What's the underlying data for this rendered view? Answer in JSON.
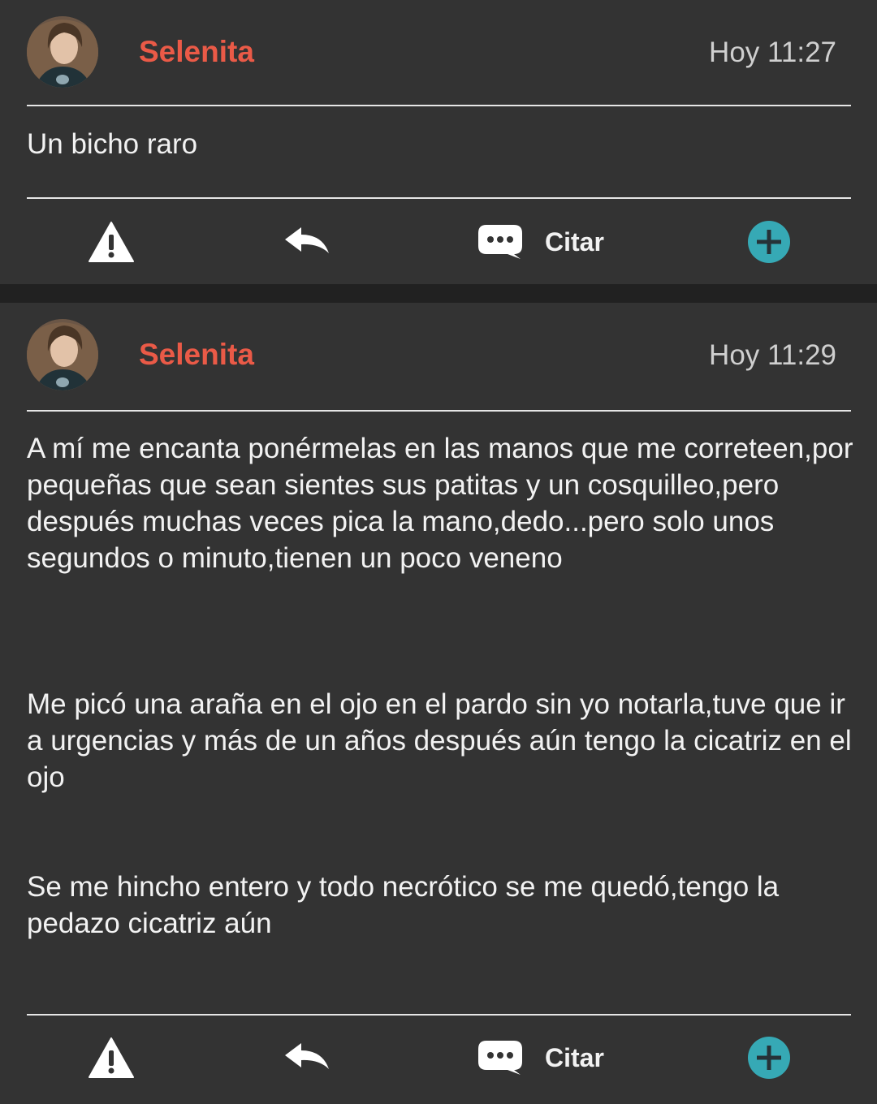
{
  "posts": [
    {
      "author": "Selenita",
      "time": "Hoy 11:27",
      "paragraphs": [
        "Un bicho raro"
      ],
      "actions": {
        "quote_label": "Citar"
      }
    },
    {
      "author": "Selenita",
      "time": "Hoy 11:29",
      "paragraphs": [
        "A mí me encanta ponérmelas en las manos que me correteen,por pequeñas que sean sientes sus patitas y un cosquilleo,pero después muchas veces pica la mano,dedo...pero solo unos segundos o minuto,tienen un poco veneno",
        "Me picó una araña en el ojo en el pardo sin yo notarla,tuve que ir a urgencias y más de un años después aún tengo la cicatriz en el ojo",
        "Se me hincho entero y todo necrótico se me quedó,tengo la pedazo cicatriz aún"
      ],
      "actions": {
        "quote_label": "Citar"
      }
    }
  ],
  "colors": {
    "username": "#ea5a47",
    "background": "#333333",
    "separator": "#212121",
    "add_button": "#36a9b5"
  },
  "icons": {
    "report": "warning-icon",
    "reply": "reply-arrow-icon",
    "quote": "speech-bubble-icon",
    "add": "plus-circle-icon"
  }
}
